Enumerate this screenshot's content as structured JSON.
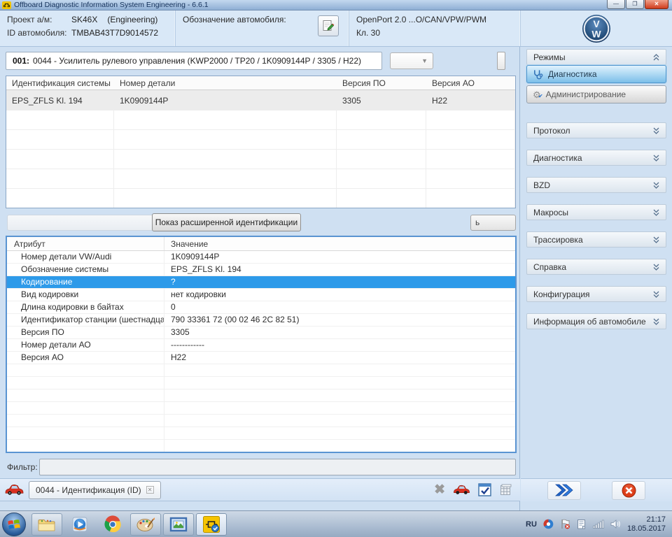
{
  "window": {
    "title": "Offboard Diagnostic Information System Engineering - 6.6.1"
  },
  "icons": {
    "minimize_glyph": "—",
    "restore_glyph": "❐",
    "close_glyph": "✕",
    "dropdown_arrow": "▼",
    "gear_glyph": "⚙",
    "gear_check_glyph": "✔",
    "gray_cross_glyph": "✖",
    "tab_close_glyph": "✕"
  },
  "colors": {
    "selection_blue": "#2d9ae9",
    "titlebar_blue": "#8fafd4",
    "vw_logo_blue": "#16335f",
    "diag_button_blue": "#7cbfe9",
    "close_button_red": "#cf3c1e"
  },
  "header": {
    "project_label": "Проект а/м:",
    "project_value": "SK46X",
    "project_note": "(Engineering)",
    "vin_label": "ID автомобиля:",
    "vin_value": "TMBAB43T7D9014572",
    "designation_label": "Обозначение автомобиля:",
    "interface_line1": "OpenPort 2.0 ...O/CAN/VPW/PWM",
    "interface_line2": "Кл. 30"
  },
  "control_bar": {
    "ecu_index": "001:",
    "ecu_title": "0044 - Усилитель рулевого управления  (KWP2000 / TP20 / 1K0909144P   / 3305 / H22)"
  },
  "ident_table": {
    "headers": [
      "Идентификация системы",
      "Номер детали",
      "Версия ПО",
      "Версия АО"
    ],
    "row": [
      "EPS_ZFLS Kl. 194",
      "1K0909144P",
      "3305",
      "H22"
    ]
  },
  "actions": {
    "show_extended": "Показ расширенной идентификации",
    "clipped_button": "ь"
  },
  "attr_table": {
    "headers": [
      "Атрибут",
      "Значение"
    ],
    "selected_index": 2,
    "rows": [
      [
        "Номер детали VW/Audi",
        "1K0909144P"
      ],
      [
        "Обозначение системы",
        "EPS_ZFLS Kl. 194"
      ],
      [
        "Кодирование",
        "?"
      ],
      [
        "Вид кодировки",
        "нет кодировки"
      ],
      [
        "Длина кодировки в байтах",
        "0"
      ],
      [
        "Идентификатор станции (шестнадцат",
        "790 33361 72 (00 02 46 2C 82 51)"
      ],
      [
        "Версия ПО",
        "3305"
      ],
      [
        "Номер детали АО",
        "------------"
      ],
      [
        "Версия АО",
        "H22"
      ]
    ]
  },
  "filter": {
    "label": "Фильтр:"
  },
  "tab_bar": {
    "active_tab": "0044 - Идентификация (ID)"
  },
  "sidebar": {
    "modes_title": "Режимы",
    "mode_buttons": [
      {
        "label": "Диагностика"
      },
      {
        "label": "Администрирование"
      }
    ],
    "sections": [
      {
        "label": "Протокол"
      },
      {
        "label": "Диагностика"
      },
      {
        "label": "BZD"
      },
      {
        "label": "Макросы"
      },
      {
        "label": "Трассировка"
      },
      {
        "label": "Справка"
      },
      {
        "label": "Конфигурация"
      },
      {
        "label": "Информация об автомобиле"
      }
    ]
  },
  "taskbar": {
    "language": "RU",
    "time": "21:17",
    "date": "18.05.2017"
  }
}
